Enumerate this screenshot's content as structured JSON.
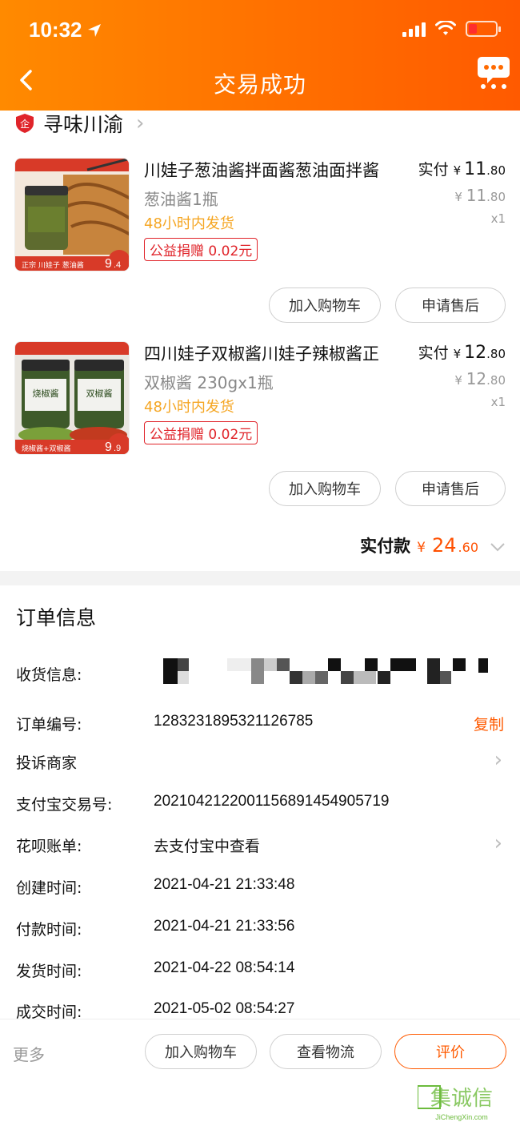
{
  "status_bar": {
    "time": "10:32"
  },
  "header": {
    "title": "交易成功"
  },
  "shop": {
    "name": "寻味川渝"
  },
  "items": [
    {
      "title": "川娃子葱油酱拌面酱葱油面拌酱",
      "spec": "葱油酱1瓶",
      "shipping": "48小时内发货",
      "charity": "公益捐赠 0.02元",
      "paid_label": "实付",
      "paid_yen": "¥",
      "paid_int": "11",
      "paid_dec": ".80",
      "orig_yen": "¥",
      "orig_int": "11",
      "orig_dec": ".80",
      "qty": "x1",
      "thumb_price_int": "9",
      "thumb_price_dec": ".4",
      "thumb_caption": "正宗 川娃子  葱油酱",
      "cart_btn": "加入购物车",
      "after_btn": "申请售后"
    },
    {
      "title": "四川娃子双椒酱川娃子辣椒酱正",
      "spec": "双椒酱 230gx1瓶",
      "shipping": "48小时内发货",
      "charity": "公益捐赠 0.02元",
      "paid_label": "实付",
      "paid_yen": "¥",
      "paid_int": "12",
      "paid_dec": ".80",
      "orig_yen": "¥",
      "orig_int": "12",
      "orig_dec": ".80",
      "qty": "x1",
      "thumb_price_int": "9",
      "thumb_price_dec": ".9",
      "thumb_caption": "烧椒酱+双椒酱",
      "thumb_jar_left": "烧椒酱",
      "thumb_jar_right": "双椒酱",
      "cart_btn": "加入购物车",
      "after_btn": "申请售后"
    }
  ],
  "total": {
    "label": "实付款",
    "yen": "¥",
    "int": "24",
    "dec": ".60"
  },
  "order_info": {
    "title": "订单信息",
    "rows": [
      {
        "label": "收货信息:",
        "value": ""
      },
      {
        "label": "订单编号:",
        "value": "1283231895321126785",
        "action": "复制"
      },
      {
        "label": "投诉商家",
        "value": ""
      },
      {
        "label": "支付宝交易号:",
        "value": "2021042122001156891454905719"
      },
      {
        "label": "花呗账单:",
        "value": "去支付宝中查看"
      },
      {
        "label": "创建时间:",
        "value": "2021-04-21 21:33:48"
      },
      {
        "label": "付款时间:",
        "value": "2021-04-21 21:33:56"
      },
      {
        "label": "发货时间:",
        "value": "2021-04-22 08:54:14"
      },
      {
        "label": "成交时间:",
        "value": "2021-05-02 08:54:27"
      }
    ]
  },
  "bottom_bar": {
    "more": "更多",
    "cart": "加入购物车",
    "logistics": "查看物流",
    "review": "评价"
  },
  "watermark": {
    "text": "集诚信",
    "sub": "JiChengXin.com"
  },
  "colors": {
    "accent": "#ff5a00",
    "header_start": "#ff8a00",
    "header_end": "#ff5a00",
    "charity": "#e0242a",
    "shipping": "#f5a623"
  }
}
